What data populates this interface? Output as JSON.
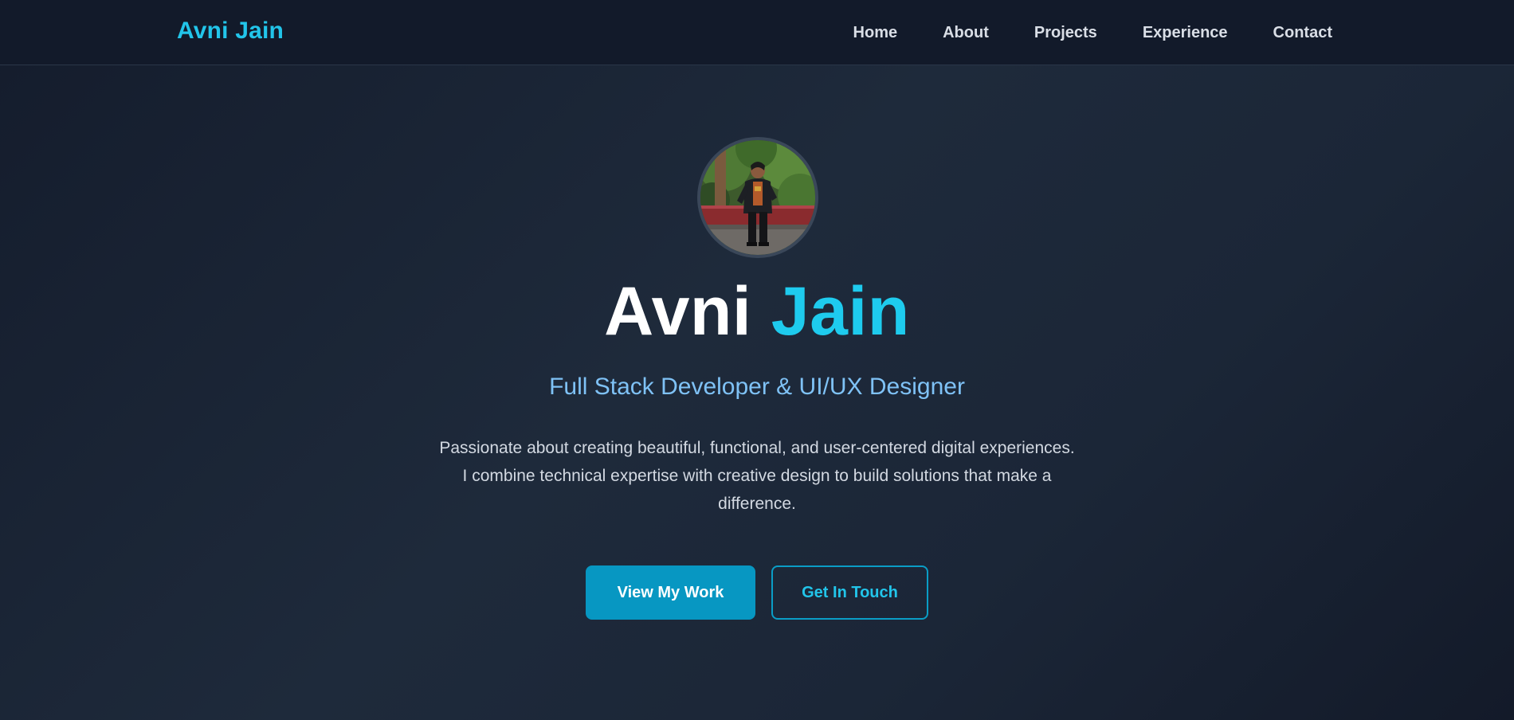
{
  "navbar": {
    "brand": "Avni Jain",
    "links": [
      {
        "label": "Home"
      },
      {
        "label": "About"
      },
      {
        "label": "Projects"
      },
      {
        "label": "Experience"
      },
      {
        "label": "Contact"
      }
    ]
  },
  "hero": {
    "title_first": "Avni",
    "title_last": "Jain",
    "subtitle": "Full Stack Developer & UI/UX Designer",
    "description": "Passionate about creating beautiful, functional, and user-centered digital experiences. I combine technical expertise with creative design to build solutions that make a difference.",
    "primary_button": "View My Work",
    "secondary_button": "Get In Touch"
  },
  "colors": {
    "accent": "#1ecbee",
    "subtitle": "#7fc2f6",
    "primary_button_bg": "#0797c2",
    "background": "#1a2434"
  }
}
